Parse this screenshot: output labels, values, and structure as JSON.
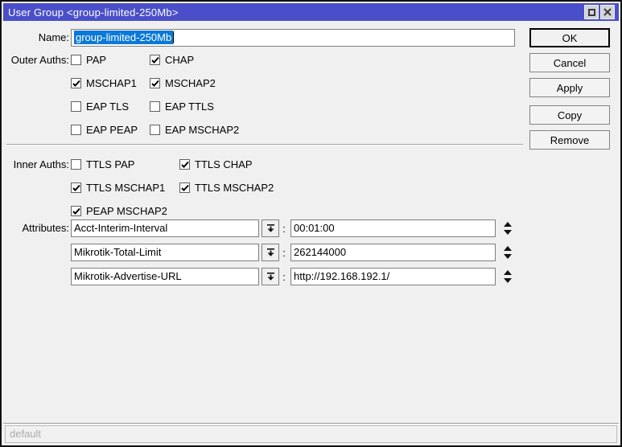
{
  "window": {
    "title": "User Group <group-limited-250Mb>"
  },
  "icons": {
    "maximize_icon": "square outline",
    "close_icon": "X cross",
    "dropdown_icon": "down arrow from bar",
    "spinner_icon": "up-down triangles",
    "checkmark_icon": "black check"
  },
  "colors": {
    "titlebar": "#4a4fc9",
    "selection": "#0b79d7",
    "dialog_bg": "#f0f0f0"
  },
  "form": {
    "name": {
      "label": "Name:",
      "value": "group-limited-250Mb"
    },
    "outer_auths": {
      "label": "Outer Auths:",
      "items": [
        {
          "label": "PAP",
          "checked": false
        },
        {
          "label": "CHAP",
          "checked": true
        },
        {
          "label": "MSCHAP1",
          "checked": true
        },
        {
          "label": "MSCHAP2",
          "checked": true
        },
        {
          "label": "EAP TLS",
          "checked": false
        },
        {
          "label": "EAP TTLS",
          "checked": false
        },
        {
          "label": "EAP PEAP",
          "checked": false
        },
        {
          "label": "EAP MSCHAP2",
          "checked": false
        }
      ]
    },
    "inner_auths": {
      "label": "Inner Auths:",
      "items": [
        {
          "label": "TTLS PAP",
          "checked": false
        },
        {
          "label": "TTLS CHAP",
          "checked": true
        },
        {
          "label": "TTLS MSCHAP1",
          "checked": true
        },
        {
          "label": "TTLS MSCHAP2",
          "checked": true
        },
        {
          "label": "PEAP MSCHAP2",
          "checked": true
        }
      ]
    },
    "attributes": {
      "label": "Attributes:",
      "separator": ":",
      "rows": [
        {
          "attribute": "Acct-Interim-Interval",
          "value": "00:01:00"
        },
        {
          "attribute": "Mikrotik-Total-Limit",
          "value": "262144000"
        },
        {
          "attribute": "Mikrotik-Advertise-URL",
          "value": "http://192.168.192.1/"
        }
      ]
    }
  },
  "buttons": {
    "ok": "OK",
    "cancel": "Cancel",
    "apply": "Apply",
    "copy": "Copy",
    "remove": "Remove"
  },
  "statusbar": {
    "text": "default"
  }
}
